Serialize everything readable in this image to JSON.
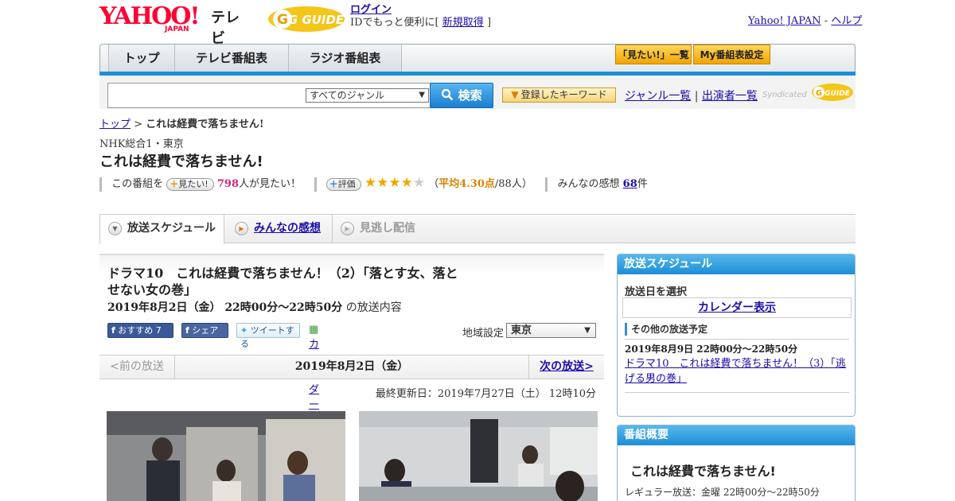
{
  "header": {
    "logo_yahoo": "YAHOO!",
    "logo_japan": "JAPAN",
    "logo_tv": "テレビ",
    "gguide_logo": "G GUIDE",
    "login_label": "ログイン",
    "id_text": "IDでもっと便利に[",
    "signup_label": "新規取得",
    "id_text_end": "]",
    "yahoo_japan_link": "Yahoo! JAPAN",
    "separator": "-",
    "help_link": "ヘルプ"
  },
  "nav": {
    "tabs": [
      "トップ",
      "テレビ番組表",
      "ラジオ番組表"
    ],
    "mitai_list": "「見たい!」一覧",
    "my_tv": "My番組表設定"
  },
  "search": {
    "input_value": "",
    "genre_selected": "すべてのジャンル",
    "search_button": "検索",
    "keyword_button": "登録したキーワード",
    "genre_list_link": "ジャンル一覧",
    "link_sep": "|",
    "performer_link": "出演者一覧",
    "syndicated": "Syndicated"
  },
  "breadcrumb": {
    "top": "トップ",
    "sep": ">",
    "current": "これは経費で落ちません!"
  },
  "program": {
    "channel": "NHK総合1・東京",
    "title": "これは経費で落ちません!",
    "this_program": "この番組を",
    "mitai_button": "見たい!",
    "mitai_count": "798",
    "mitai_suffix": "人が見たい！",
    "rating_button": "評価",
    "rating_value": 4.3,
    "rating_text_open": "（",
    "rating_avg": "平均4.30点",
    "rating_people": "/88人）",
    "kansou_label": "みんなの感想",
    "kansou_count": "68",
    "kansou_suffix": "件"
  },
  "tabs": {
    "schedule": "放送スケジュール",
    "kansou": "みんなの感想",
    "minogashi": "見逃し配信"
  },
  "episode": {
    "title": "ドラマ10　これは経費で落ちません！（2）「落とす女、落とせない女の巻」",
    "datetime": "2019年8月2日（金）  22時00分～22時50分",
    "datetime_suffix": "の放送内容",
    "like_button": "おすすめ 7",
    "share_button": "シェア",
    "tweet_button": "ツイートする",
    "calendar_link": "カレンダーに登録",
    "region_label": "地域設定",
    "region_value": "東京"
  },
  "pager": {
    "prev": "<前の放送",
    "current": "2019年8月2日（金）",
    "next": "次の放送>"
  },
  "updated": "最終更新日：2019年7月27日（土）  12時10分",
  "side_schedule": {
    "heading": "放送スケジュール",
    "select_date": "放送日を選択",
    "calendar_button": "カレンダー表示",
    "other_heading": "その他の放送予定",
    "other_date": "2019年8月9日  22時00分～22時50分",
    "other_title": "ドラマ10　これは経費で落ちません！（3）「逃げる男の巻」"
  },
  "side_gaiyou": {
    "heading": "番組概要",
    "title": "これは経費で落ちません!",
    "regular": "レギュラー放送：金曜 22時00分～22時50分"
  },
  "colors": {
    "accent_blue": "#1c8fd8",
    "yahoo_red": "#ff0033",
    "link": "#1a0dab",
    "star": "#f0a800"
  }
}
